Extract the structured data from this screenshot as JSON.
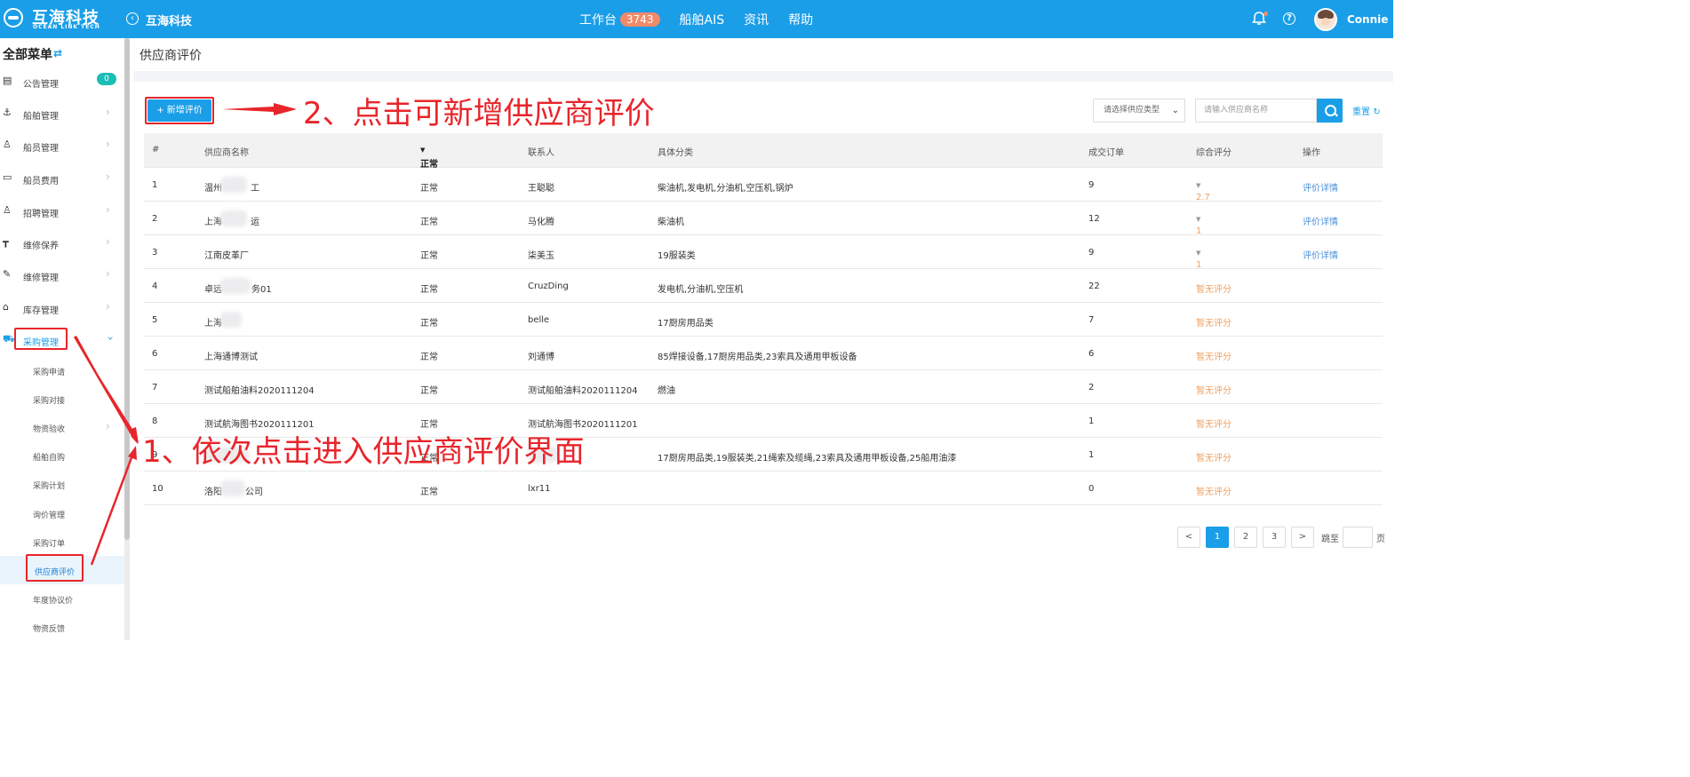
{
  "header": {
    "brand_name": "互海科技",
    "brand_sub": "OCEAN LINK TECH",
    "title": "互海科技",
    "nav": [
      {
        "label": "工作台",
        "badge": "3743"
      },
      {
        "label": "船舶AIS"
      },
      {
        "label": "资讯"
      },
      {
        "label": "帮助"
      }
    ],
    "username": "Connie"
  },
  "sidebar": {
    "title": "全部菜单",
    "toggle_icon": "⇄",
    "items": [
      {
        "label": "公告管理",
        "icon": "notice-icon",
        "badge": "0"
      },
      {
        "label": "船舶管理",
        "icon": "anchor-icon"
      },
      {
        "label": "船员管理",
        "icon": "user-icon"
      },
      {
        "label": "船员费用",
        "icon": "wallet-icon"
      },
      {
        "label": "招聘管理",
        "icon": "recruit-icon"
      },
      {
        "label": "维修保养",
        "icon": "tool-icon"
      },
      {
        "label": "维修管理",
        "icon": "wrench-icon"
      },
      {
        "label": "库存管理",
        "icon": "home-icon"
      },
      {
        "label": "采购管理",
        "icon": "cart-icon"
      }
    ],
    "sub_items": [
      {
        "label": "采购申请"
      },
      {
        "label": "采购对接"
      },
      {
        "label": "物资验收"
      },
      {
        "label": "船舶自购"
      },
      {
        "label": "采购计划"
      },
      {
        "label": "询价管理"
      },
      {
        "label": "采购订单"
      },
      {
        "label": "供应商评价"
      },
      {
        "label": "年度协议价"
      },
      {
        "label": "物资反馈"
      }
    ]
  },
  "page": {
    "title": "供应商评价",
    "add_button": "+ 新增评价",
    "type_select": "请选择供应类型",
    "name_placeholder": "请输入供应商名称",
    "reset": "重置"
  },
  "table": {
    "headers": [
      "#",
      "供应商名称",
      "正常",
      "联系人",
      "具体分类",
      "成交订单",
      "综合评分",
      "操作"
    ],
    "rows": [
      {
        "no": "1",
        "name_a": "温州",
        "name_b": "工",
        "status": "正常",
        "contact": "王聪聪",
        "category": "柴油机,发电机,分油机,空压机,锅炉",
        "orders": "9",
        "rating": "2.7",
        "action": "评价详情"
      },
      {
        "no": "2",
        "name_a": "上海",
        "name_b": "运",
        "status": "正常",
        "contact": "马化腾",
        "category": "柴油机",
        "orders": "12",
        "rating": "1",
        "action": "评价详情"
      },
      {
        "no": "3",
        "name_a": "江南皮革厂",
        "name_b": "",
        "status": "正常",
        "contact": "柒美玉",
        "category": "19服装类",
        "orders": "9",
        "rating": "1",
        "action": "评价详情"
      },
      {
        "no": "4",
        "name_a": "卓远",
        "name_b": "务01",
        "status": "正常",
        "contact": "CruzDing",
        "category": "发电机,分油机,空压机",
        "orders": "22",
        "rating": "暂无评分",
        "action": ""
      },
      {
        "no": "5",
        "name_a": "上海",
        "name_b": "",
        "status": "正常",
        "contact": "belle",
        "category": "17厨房用品类",
        "orders": "7",
        "rating": "暂无评分",
        "action": ""
      },
      {
        "no": "6",
        "name_a": "上海通博测试",
        "name_b": "",
        "status": "正常",
        "contact": "刘通博",
        "category": "85焊接设备,17厨房用品类,23索具及通用甲板设备",
        "orders": "6",
        "rating": "暂无评分",
        "action": ""
      },
      {
        "no": "7",
        "name_a": "测试船舶油料2020111204",
        "name_b": "",
        "status": "正常",
        "contact": "测试船舶油料2020111204",
        "category": "燃油",
        "orders": "2",
        "rating": "暂无评分",
        "action": ""
      },
      {
        "no": "8",
        "name_a": "测试航海图书2020111201",
        "name_b": "",
        "status": "正常",
        "contact": "测试航海图书2020111201",
        "category": "",
        "orders": "1",
        "rating": "暂无评分",
        "action": ""
      },
      {
        "no": "9",
        "name_a": "",
        "name_b": "",
        "status": "正常",
        "contact": "",
        "category": "17厨房用品类,19服装类,21绳索及缆绳,23索具及通用甲板设备,25船用油漆",
        "orders": "1",
        "rating": "暂无评分",
        "action": ""
      },
      {
        "no": "10",
        "name_a": "洛阳",
        "name_b": "公司",
        "status": "正常",
        "contact": "lxr11",
        "category": "",
        "orders": "0",
        "rating": "暂无评分",
        "action": ""
      }
    ]
  },
  "pagination": {
    "prev": "<",
    "pages": [
      "1",
      "2",
      "3"
    ],
    "current": "1",
    "next": ">",
    "jump_label": "跳至",
    "unit": "页"
  },
  "annotations": {
    "step1": "1、依次点击进入供应商评价界面",
    "step2": "2、点击可新增供应商评价"
  },
  "colors": {
    "header_bg": "#1a9ee8",
    "accent": "#1a9ee8",
    "annotation_red": "#e8252b",
    "rating_orange": "#f0a060",
    "link_blue": "#4a90d9"
  }
}
